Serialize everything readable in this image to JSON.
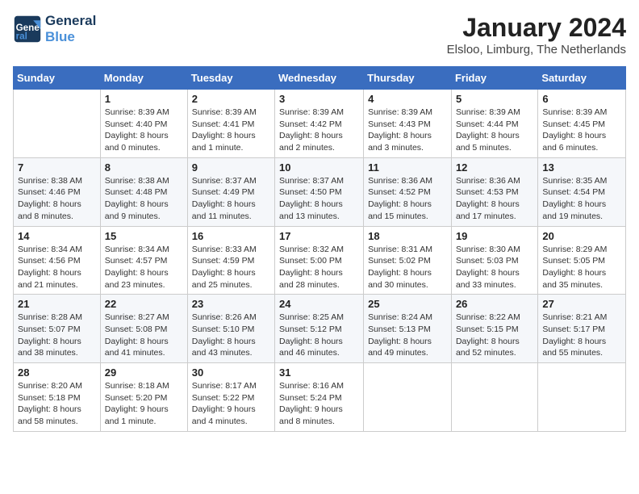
{
  "header": {
    "logo_line1": "General",
    "logo_line2": "Blue",
    "month": "January 2024",
    "location": "Elsloo, Limburg, The Netherlands"
  },
  "weekdays": [
    "Sunday",
    "Monday",
    "Tuesday",
    "Wednesday",
    "Thursday",
    "Friday",
    "Saturday"
  ],
  "weeks": [
    [
      {
        "day": "",
        "sunrise": "",
        "sunset": "",
        "daylight": ""
      },
      {
        "day": "1",
        "sunrise": "Sunrise: 8:39 AM",
        "sunset": "Sunset: 4:40 PM",
        "daylight": "Daylight: 8 hours and 0 minutes."
      },
      {
        "day": "2",
        "sunrise": "Sunrise: 8:39 AM",
        "sunset": "Sunset: 4:41 PM",
        "daylight": "Daylight: 8 hours and 1 minute."
      },
      {
        "day": "3",
        "sunrise": "Sunrise: 8:39 AM",
        "sunset": "Sunset: 4:42 PM",
        "daylight": "Daylight: 8 hours and 2 minutes."
      },
      {
        "day": "4",
        "sunrise": "Sunrise: 8:39 AM",
        "sunset": "Sunset: 4:43 PM",
        "daylight": "Daylight: 8 hours and 3 minutes."
      },
      {
        "day": "5",
        "sunrise": "Sunrise: 8:39 AM",
        "sunset": "Sunset: 4:44 PM",
        "daylight": "Daylight: 8 hours and 5 minutes."
      },
      {
        "day": "6",
        "sunrise": "Sunrise: 8:39 AM",
        "sunset": "Sunset: 4:45 PM",
        "daylight": "Daylight: 8 hours and 6 minutes."
      }
    ],
    [
      {
        "day": "7",
        "sunrise": "Sunrise: 8:38 AM",
        "sunset": "Sunset: 4:46 PM",
        "daylight": "Daylight: 8 hours and 8 minutes."
      },
      {
        "day": "8",
        "sunrise": "Sunrise: 8:38 AM",
        "sunset": "Sunset: 4:48 PM",
        "daylight": "Daylight: 8 hours and 9 minutes."
      },
      {
        "day": "9",
        "sunrise": "Sunrise: 8:37 AM",
        "sunset": "Sunset: 4:49 PM",
        "daylight": "Daylight: 8 hours and 11 minutes."
      },
      {
        "day": "10",
        "sunrise": "Sunrise: 8:37 AM",
        "sunset": "Sunset: 4:50 PM",
        "daylight": "Daylight: 8 hours and 13 minutes."
      },
      {
        "day": "11",
        "sunrise": "Sunrise: 8:36 AM",
        "sunset": "Sunset: 4:52 PM",
        "daylight": "Daylight: 8 hours and 15 minutes."
      },
      {
        "day": "12",
        "sunrise": "Sunrise: 8:36 AM",
        "sunset": "Sunset: 4:53 PM",
        "daylight": "Daylight: 8 hours and 17 minutes."
      },
      {
        "day": "13",
        "sunrise": "Sunrise: 8:35 AM",
        "sunset": "Sunset: 4:54 PM",
        "daylight": "Daylight: 8 hours and 19 minutes."
      }
    ],
    [
      {
        "day": "14",
        "sunrise": "Sunrise: 8:34 AM",
        "sunset": "Sunset: 4:56 PM",
        "daylight": "Daylight: 8 hours and 21 minutes."
      },
      {
        "day": "15",
        "sunrise": "Sunrise: 8:34 AM",
        "sunset": "Sunset: 4:57 PM",
        "daylight": "Daylight: 8 hours and 23 minutes."
      },
      {
        "day": "16",
        "sunrise": "Sunrise: 8:33 AM",
        "sunset": "Sunset: 4:59 PM",
        "daylight": "Daylight: 8 hours and 25 minutes."
      },
      {
        "day": "17",
        "sunrise": "Sunrise: 8:32 AM",
        "sunset": "Sunset: 5:00 PM",
        "daylight": "Daylight: 8 hours and 28 minutes."
      },
      {
        "day": "18",
        "sunrise": "Sunrise: 8:31 AM",
        "sunset": "Sunset: 5:02 PM",
        "daylight": "Daylight: 8 hours and 30 minutes."
      },
      {
        "day": "19",
        "sunrise": "Sunrise: 8:30 AM",
        "sunset": "Sunset: 5:03 PM",
        "daylight": "Daylight: 8 hours and 33 minutes."
      },
      {
        "day": "20",
        "sunrise": "Sunrise: 8:29 AM",
        "sunset": "Sunset: 5:05 PM",
        "daylight": "Daylight: 8 hours and 35 minutes."
      }
    ],
    [
      {
        "day": "21",
        "sunrise": "Sunrise: 8:28 AM",
        "sunset": "Sunset: 5:07 PM",
        "daylight": "Daylight: 8 hours and 38 minutes."
      },
      {
        "day": "22",
        "sunrise": "Sunrise: 8:27 AM",
        "sunset": "Sunset: 5:08 PM",
        "daylight": "Daylight: 8 hours and 41 minutes."
      },
      {
        "day": "23",
        "sunrise": "Sunrise: 8:26 AM",
        "sunset": "Sunset: 5:10 PM",
        "daylight": "Daylight: 8 hours and 43 minutes."
      },
      {
        "day": "24",
        "sunrise": "Sunrise: 8:25 AM",
        "sunset": "Sunset: 5:12 PM",
        "daylight": "Daylight: 8 hours and 46 minutes."
      },
      {
        "day": "25",
        "sunrise": "Sunrise: 8:24 AM",
        "sunset": "Sunset: 5:13 PM",
        "daylight": "Daylight: 8 hours and 49 minutes."
      },
      {
        "day": "26",
        "sunrise": "Sunrise: 8:22 AM",
        "sunset": "Sunset: 5:15 PM",
        "daylight": "Daylight: 8 hours and 52 minutes."
      },
      {
        "day": "27",
        "sunrise": "Sunrise: 8:21 AM",
        "sunset": "Sunset: 5:17 PM",
        "daylight": "Daylight: 8 hours and 55 minutes."
      }
    ],
    [
      {
        "day": "28",
        "sunrise": "Sunrise: 8:20 AM",
        "sunset": "Sunset: 5:18 PM",
        "daylight": "Daylight: 8 hours and 58 minutes."
      },
      {
        "day": "29",
        "sunrise": "Sunrise: 8:18 AM",
        "sunset": "Sunset: 5:20 PM",
        "daylight": "Daylight: 9 hours and 1 minute."
      },
      {
        "day": "30",
        "sunrise": "Sunrise: 8:17 AM",
        "sunset": "Sunset: 5:22 PM",
        "daylight": "Daylight: 9 hours and 4 minutes."
      },
      {
        "day": "31",
        "sunrise": "Sunrise: 8:16 AM",
        "sunset": "Sunset: 5:24 PM",
        "daylight": "Daylight: 9 hours and 8 minutes."
      },
      {
        "day": "",
        "sunrise": "",
        "sunset": "",
        "daylight": ""
      },
      {
        "day": "",
        "sunrise": "",
        "sunset": "",
        "daylight": ""
      },
      {
        "day": "",
        "sunrise": "",
        "sunset": "",
        "daylight": ""
      }
    ]
  ]
}
